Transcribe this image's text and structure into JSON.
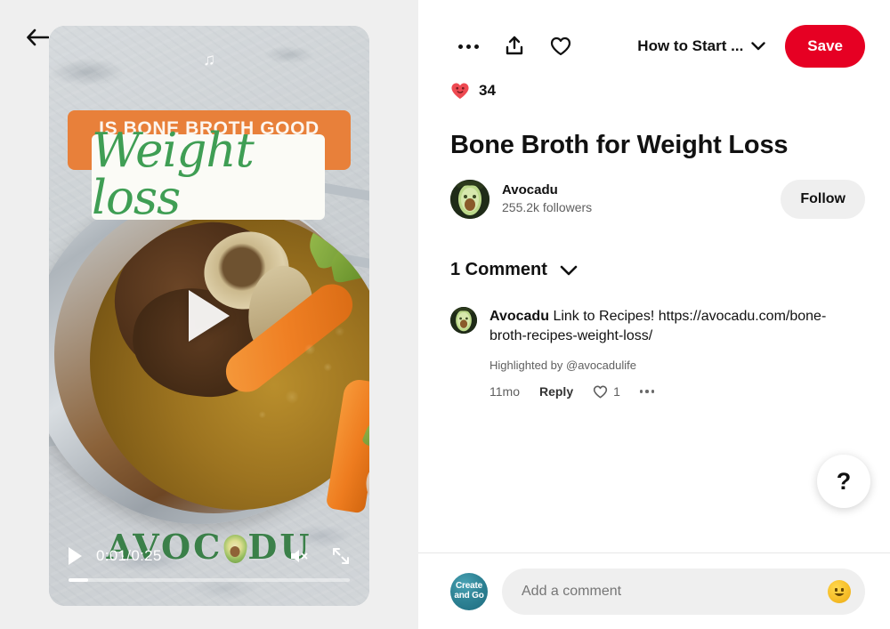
{
  "nav": {
    "back_icon": "arrow-left-icon"
  },
  "video": {
    "music_icon": "music-note-icon",
    "headline_top": "IS BONE BROTH GOOD FOR",
    "headline_bottom": "Weight loss",
    "watermark": "AVOC DU",
    "watermark_left": "AVOC",
    "watermark_right": "DU",
    "current_time": "0:01",
    "separator": "/",
    "duration": "0:25",
    "play_icon": "play-icon",
    "mute_icon": "mute-icon",
    "fullscreen_icon": "fullscreen-icon",
    "progress_percent": 7
  },
  "toolbar": {
    "more_icon": "more-options-icon",
    "share_icon": "share-icon",
    "favorite_icon": "heart-outline-icon",
    "board_name": "How to Start ...",
    "chevron_icon": "chevron-down-icon",
    "save_label": "Save"
  },
  "reaction": {
    "emoji": "smiling-heart-emoji",
    "count": "34"
  },
  "pin": {
    "title": "Bone Broth for Weight Loss",
    "author_name": "Avocadu",
    "author_followers": "255.2k followers",
    "follow_label": "Follow"
  },
  "comments": {
    "header": "1 Comment",
    "chevron_icon": "chevron-down-icon",
    "items": [
      {
        "author": "Avocadu",
        "text": "Link to Recipes! https://avocadu.com/bone-broth-recipes-weight-loss/",
        "highlight": "Highlighted by @avocadulife",
        "time": "11mo",
        "reply_label": "Reply",
        "like_count": "1",
        "more_icon": "more-options-icon"
      }
    ]
  },
  "help": {
    "label": "?"
  },
  "composer": {
    "avatar_line1": "Create",
    "avatar_line2": "and Go",
    "placeholder": "Add a comment",
    "value": "",
    "emoji_icon": "smiley-emoji-icon"
  },
  "colors": {
    "accent": "#e60023",
    "surface": "#efefef",
    "text": "#111111",
    "muted": "#5f5f5f"
  }
}
